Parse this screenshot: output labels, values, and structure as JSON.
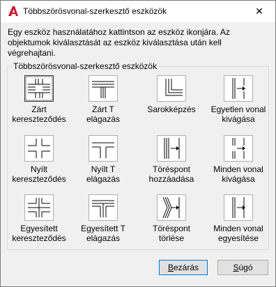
{
  "window": {
    "title": "Többszörösvonal-szerkesztő eszközök",
    "close_glyph": "✕"
  },
  "description": "Egy eszköz használatához kattintson az eszköz ikonjára. Az objektumok kiválasztását az eszköz kiválasztása után kell végrehajtani.",
  "group_label": "Többszörösvonal-szerkesztő eszközök",
  "tools": [
    {
      "label": "Zárt\nkereszteződés",
      "icon": "closed-cross-icon",
      "selected": true
    },
    {
      "label": "Zárt T\nelágazás",
      "icon": "closed-tee-icon"
    },
    {
      "label": "Sarokképzés",
      "icon": "corner-joint-icon"
    },
    {
      "label": "Egyetlen vonal\nkivágása",
      "icon": "cut-single-icon"
    },
    {
      "label": "Nyílt\nkereszteződés",
      "icon": "open-cross-icon"
    },
    {
      "label": "Nyílt T\nelágazás",
      "icon": "open-tee-icon"
    },
    {
      "label": "Töréspont\nhozzáadása",
      "icon": "add-vertex-icon"
    },
    {
      "label": "Minden vonal\nkivágása",
      "icon": "cut-all-icon"
    },
    {
      "label": "Egyesített\nkereszteződés",
      "icon": "merged-cross-icon"
    },
    {
      "label": "Egyesített T\nelágazás",
      "icon": "merged-tee-icon"
    },
    {
      "label": "Töréspont\ntörlése",
      "icon": "delete-vertex-icon"
    },
    {
      "label": "Minden vonal\negyesítése",
      "icon": "weld-all-icon"
    }
  ],
  "buttons": {
    "close_label_pre": "",
    "close_label_u": "B",
    "close_label_post": "ezárás",
    "help_label_pre": "",
    "help_label_u": "S",
    "help_label_post": "úgó"
  },
  "colors": {
    "accent_red": "#c8102e",
    "focus_blue": "#0078d7"
  }
}
